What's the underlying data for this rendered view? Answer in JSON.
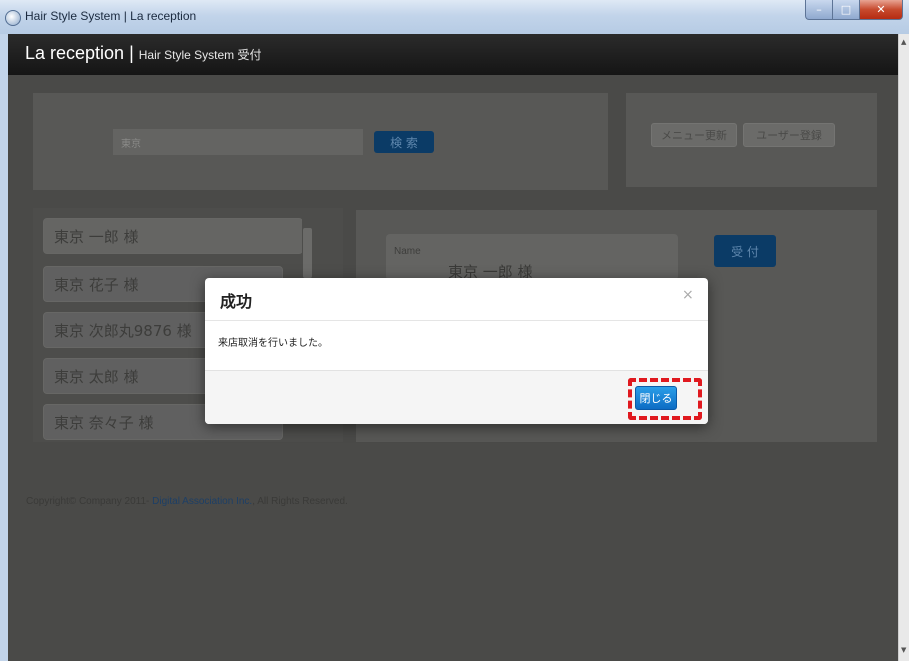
{
  "window": {
    "title": "Hair Style System | La reception"
  },
  "navbar": {
    "brand": "La reception",
    "separator": "|",
    "subtitle": "Hair Style System 受付"
  },
  "search": {
    "value": "東京",
    "button_label": "検 索"
  },
  "toolbar": {
    "menu_refresh_label": "メニュー更新",
    "user_register_label": "ユーザー登録"
  },
  "customers": [
    {
      "label": "東京 一郎  様"
    },
    {
      "label": "東京 花子  様"
    },
    {
      "label": "東京 次郎丸9876  様"
    },
    {
      "label": "東京 太郎  様"
    },
    {
      "label": "東京 奈々子  様"
    }
  ],
  "detail": {
    "name_label": "Name",
    "name_value": "東京 一郎  様",
    "reception_button": "受 付"
  },
  "footer": {
    "prefix": "Copyright© Company 2011- ",
    "link": "Digital Association Inc.",
    "suffix": ", All Rights Reserved."
  },
  "modal": {
    "title": "成功",
    "close_glyph": "×",
    "message": "来店取消を行いました。",
    "close_button": "閉じる"
  },
  "colors": {
    "highlight": "#e0191f",
    "primary_button": "#0d6cc4"
  }
}
